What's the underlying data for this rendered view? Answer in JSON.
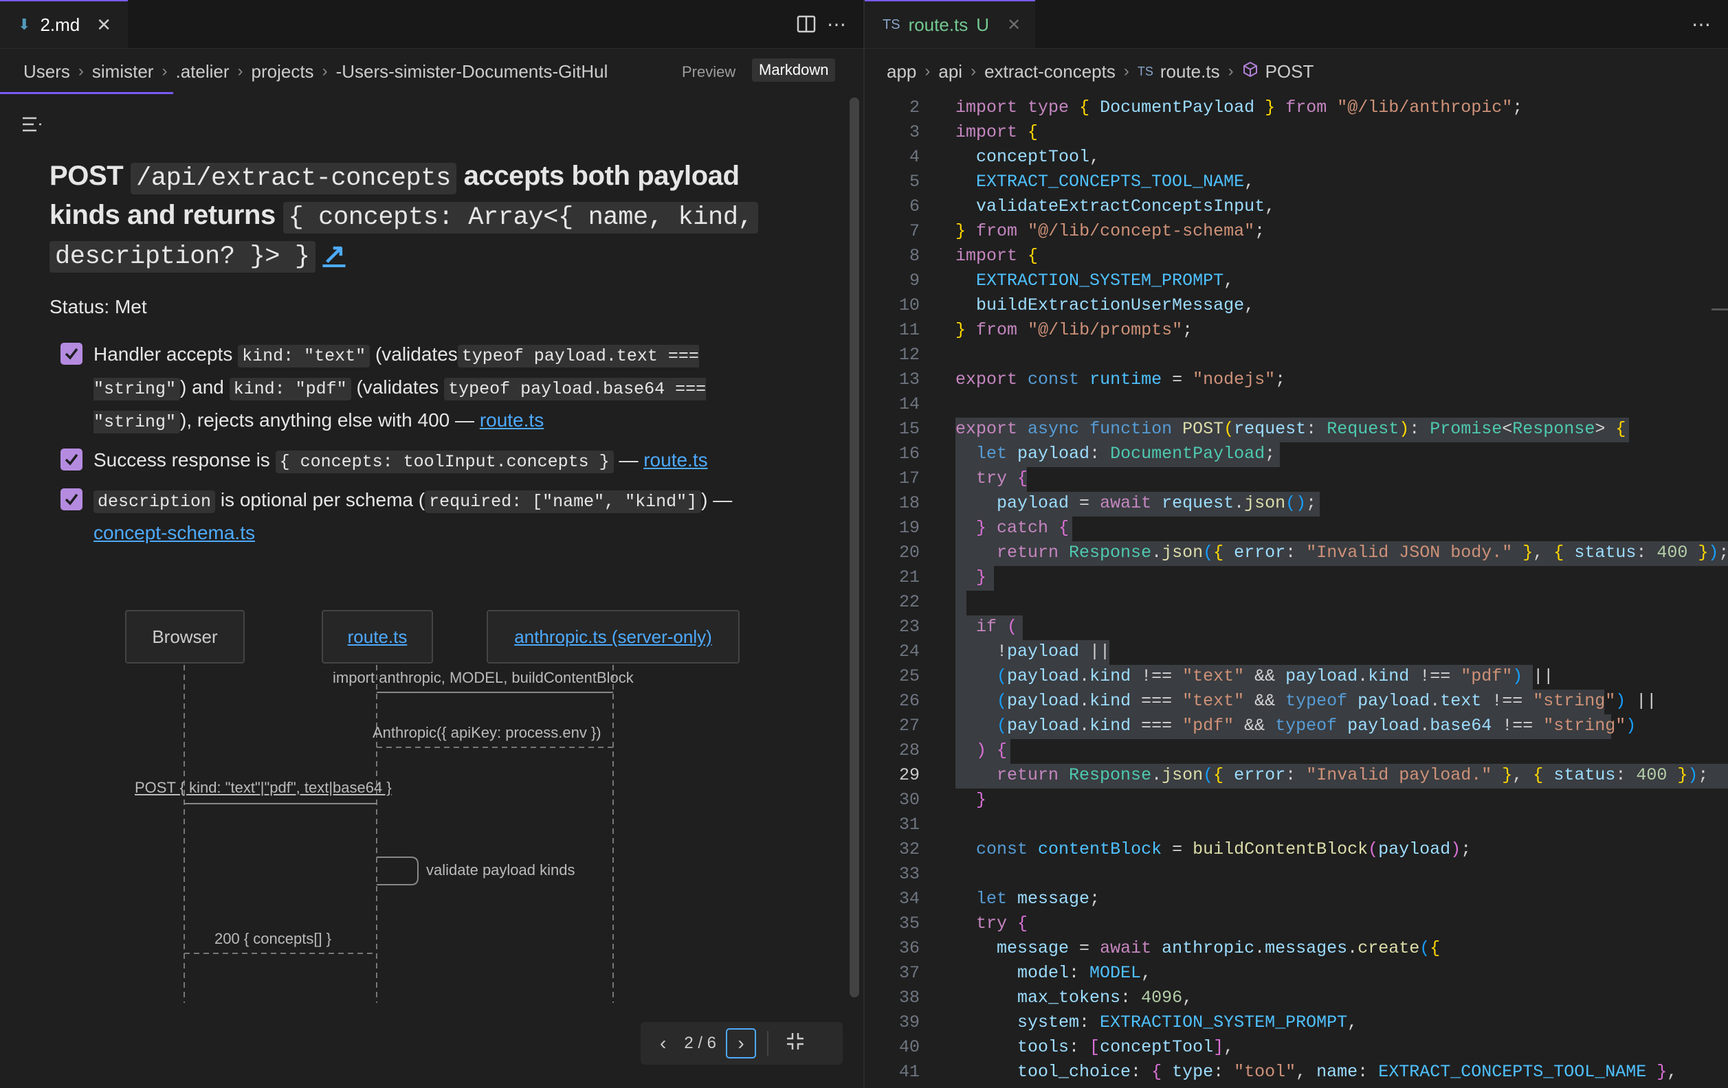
{
  "left": {
    "tab": {
      "label": "2.md"
    },
    "breadcrumbs": [
      "Users",
      "simister",
      ".atelier",
      "projects",
      "-Users-simister-Documents-GitHul"
    ],
    "view_toggle": {
      "preview": "Preview",
      "markdown": "Markdown"
    },
    "heading": {
      "part1": "POST",
      "code1": "/api/extract-concepts",
      "part2": "accepts both payload kinds and returns",
      "code2": "{ concepts: Array<{ name, kind,",
      "code3": "description? }> }",
      "link_icon": "↗"
    },
    "status": "Status: Met",
    "checks": [
      {
        "checked": true,
        "t1": "Handler accepts",
        "c1": "kind: \"text\"",
        "t2": "(validates",
        "c2": "typeof payload.text === \"string\"",
        "t3": ")",
        "t4": "and",
        "c3": "kind: \"pdf\"",
        "t5": "(validates",
        "c4": "typeof payload.base64 === \"string\"",
        "t6": "), rejects",
        "t7": "anything else with 400 —",
        "link": "route.ts"
      },
      {
        "checked": true,
        "t1": "Success response is",
        "c1": "{ concepts: toolInput.concepts }",
        "t2": "—",
        "link": "route.ts"
      },
      {
        "checked": true,
        "c1": "description",
        "t1": "is optional per schema (",
        "c2": "required: [\"name\", \"kind\"]",
        "t2": ") —",
        "link": "concept-schema.ts"
      }
    ],
    "diagram": {
      "actors": [
        "Browser",
        "route.ts",
        "anthropic.ts (server-only)"
      ],
      "messages": [
        "import anthropic, MODEL, buildContentBlock",
        "Anthropic({ apiKey: process.env })",
        "POST { kind: \"text\"|\"pdf\", text|base64 }",
        "validate payload kinds",
        "200 { concepts[] }"
      ]
    },
    "pager": {
      "label": "2 / 6"
    }
  },
  "right": {
    "tab": {
      "prefix": "TS",
      "label": "route.ts",
      "status": "U"
    },
    "breadcrumbs": [
      "app",
      "api",
      "extract-concepts",
      "route.ts",
      "POST"
    ],
    "breadcrumb_ts": "TS",
    "current_line": 29,
    "lines": [
      {
        "n": "2"
      },
      {
        "n": "3"
      },
      {
        "n": "4"
      },
      {
        "n": "5"
      },
      {
        "n": "6"
      },
      {
        "n": "7"
      },
      {
        "n": "8"
      },
      {
        "n": "9"
      },
      {
        "n": "10"
      },
      {
        "n": "11"
      },
      {
        "n": "12"
      },
      {
        "n": "13"
      },
      {
        "n": "14"
      },
      {
        "n": "15"
      },
      {
        "n": "16"
      },
      {
        "n": "17"
      },
      {
        "n": "18"
      },
      {
        "n": "19"
      },
      {
        "n": "20"
      },
      {
        "n": "21"
      },
      {
        "n": "22"
      },
      {
        "n": "23"
      },
      {
        "n": "24"
      },
      {
        "n": "25"
      },
      {
        "n": "26"
      },
      {
        "n": "27"
      },
      {
        "n": "28"
      },
      {
        "n": "29"
      },
      {
        "n": "30"
      },
      {
        "n": "31"
      },
      {
        "n": "32"
      },
      {
        "n": "33"
      },
      {
        "n": "34"
      },
      {
        "n": "35"
      },
      {
        "n": "36"
      },
      {
        "n": "37"
      },
      {
        "n": "38"
      },
      {
        "n": "39"
      },
      {
        "n": "40"
      },
      {
        "n": "41"
      }
    ]
  },
  "colors": {
    "accent": "#7a5af8",
    "link": "#4daafc",
    "checkbox": "#b58be0"
  }
}
